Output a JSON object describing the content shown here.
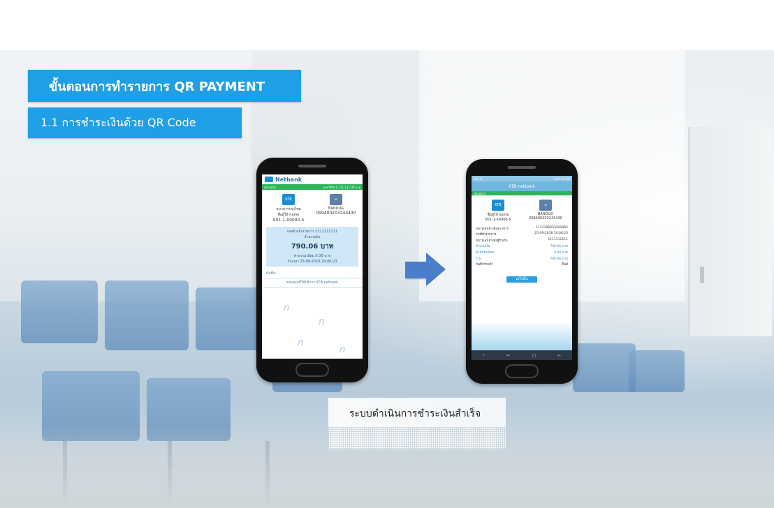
{
  "title": "ขั้นตอนการทำรายการ QR PAYMENT",
  "subtitle": "1.1 การชำระเงินด้วย QR Code",
  "caption": "ระบบดำเนินการชำระเงินสำเร็จ",
  "phone1": {
    "app_name": "Netbank",
    "status_left": "หน้าถัดไป",
    "status_right": "ยอดใช้ได้ 1,111,111.00 บาท",
    "from_name": "ธนาคารกรุงไทย",
    "from_user": "ชื่อผู้ใช้ name",
    "from_account": "001-1-X0000-5",
    "to_bank": "BANDUG",
    "to_account": "099400203244430",
    "ref_label": "เลขอ้างอิงรายการ 1111111111",
    "amount_label": "จำนวนเงิน",
    "amount": "790.06 บาท",
    "fee": "ค่าธรรมเนียม 0.00 บาท",
    "date": "วันเวลา 25-09-2018 10:06:23",
    "memo_label": "บันทึก:",
    "thanks": "ขอบคุณที่ใช้บริการ KTB netbank"
  },
  "phone2": {
    "status_left": "AIS 3G",
    "status_right": "100% 11:08",
    "header": "KTB netbank",
    "section": "หน้าถัดไป",
    "from_user": "ชื่อผู้ใช้ name",
    "from_account": "001-1-X0000-5",
    "to_bank": "BANDUG",
    "to_account": "099400203244430",
    "rows": [
      {
        "k": "หมายเลขอ้างอิงธนาคาร",
        "v": "1112106053201892"
      },
      {
        "k": "วันที่ทำรายการ",
        "v": "25-09-2018 10:06:23"
      },
      {
        "k": "หมายเลขอ้างอิงผู้รับเงิน",
        "v": "1111111111"
      },
      {
        "k": "จำนวนเงิน",
        "v": "790.06 บาท"
      },
      {
        "k": "ค่าธรรมเนียม",
        "v": "0.00 บาท"
      },
      {
        "k": "รวม",
        "v": "790.06 บาท"
      },
      {
        "k": "บันทึกช่วยจำ",
        "v": "คืนดี"
      }
    ],
    "ok_label": "เสร็จสิ้น"
  }
}
